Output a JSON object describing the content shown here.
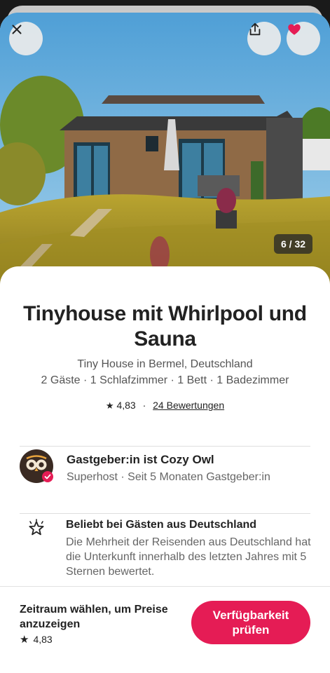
{
  "hero": {
    "photo_counter": "6 / 32",
    "close_icon": "close-icon",
    "share_icon": "share-icon",
    "favorite_icon": "heart-icon",
    "favorite_color": "#e51c55"
  },
  "listing": {
    "title": "Tinyhouse mit Whirlpool und Sauna",
    "subtitle_line1": "Tiny House in Bermel, Deutschland",
    "subtitle_line2": "2 Gäste · 1 Schlafzimmer · 1 Bett · 1 Badezimmer",
    "rating": "4,83",
    "separator": "·",
    "reviews": "24 Bewertungen"
  },
  "host": {
    "title": "Gastgeber:in ist Cozy Owl",
    "subtitle": "Superhost · Seit 5 Monaten Gastgeber:in"
  },
  "highlight": {
    "title": "Beliebt bei Gästen aus Deutschland",
    "description": "Die Mehrheit der Reisenden aus Deutschland hat die Unterkunft innerhalb des letzten Jahres mit 5 Sternen bewertet."
  },
  "footer": {
    "price_prompt": "Zeitraum wählen, um Preise anzuzeigen",
    "rating": "4,83",
    "cta_label": "Verfügbarkeit prüfen",
    "cta_color": "#e51c55"
  }
}
